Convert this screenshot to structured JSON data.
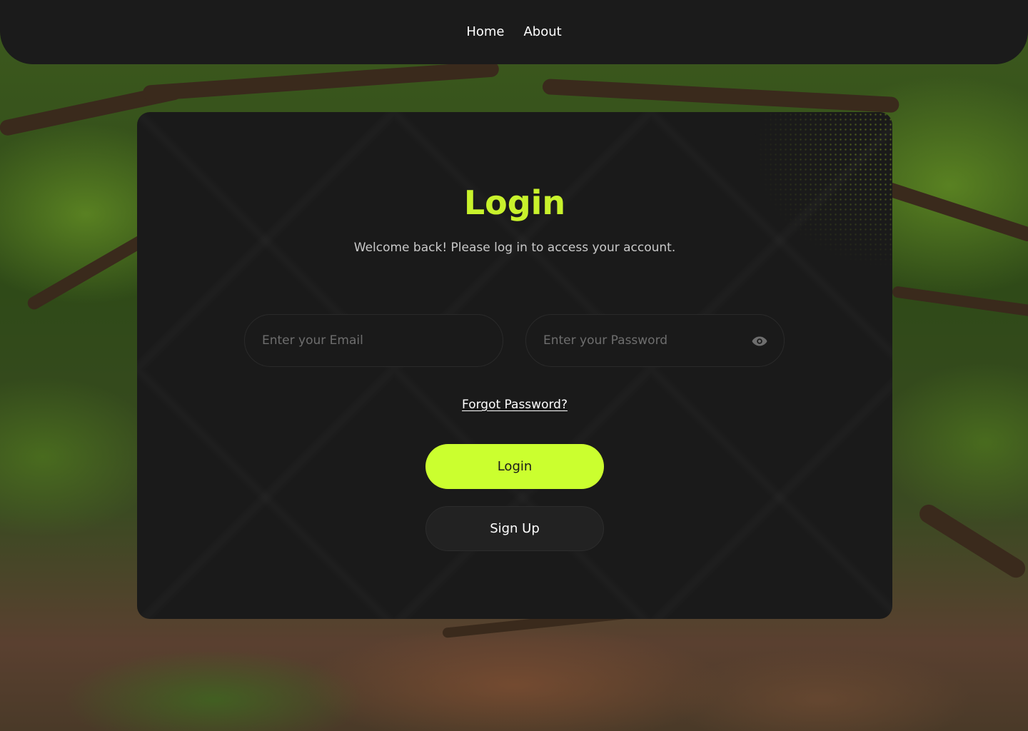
{
  "nav": {
    "home_label": "Home",
    "about_label": "About"
  },
  "login": {
    "title": "Login",
    "subtitle": "Welcome back! Please log in to access your account.",
    "email_placeholder": "Enter your Email",
    "email_value": "",
    "password_placeholder": "Enter your Password",
    "password_value": "",
    "password_toggle_icon": "eye-icon",
    "forgot_label": "Forgot Password?",
    "login_button": "Login",
    "signup_button": "Sign Up"
  },
  "colors": {
    "accent": "#cbff2f",
    "title": "#c8f22c",
    "card_bg": "#1a1a1a",
    "nav_bg": "#1b1b1b"
  }
}
